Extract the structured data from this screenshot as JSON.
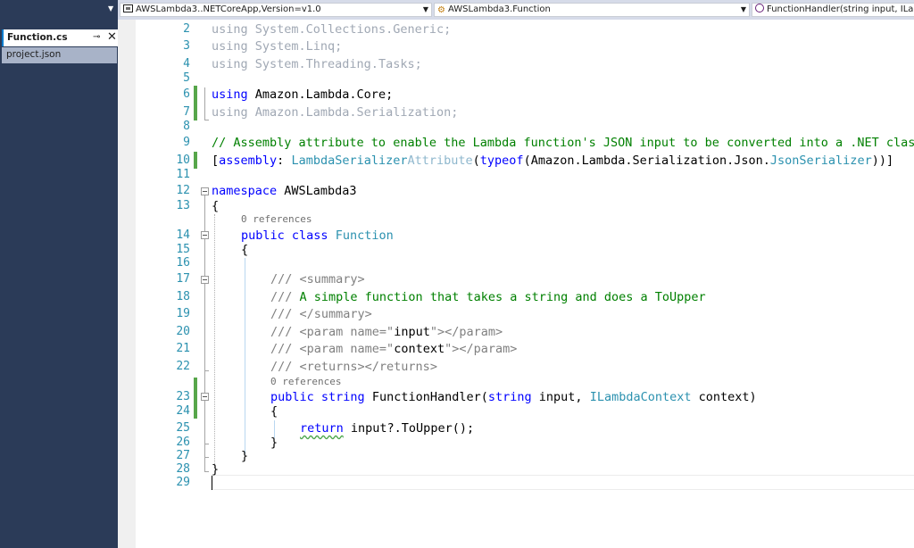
{
  "toolbar": {
    "project_dropdown": "AWSLambda3..NETCoreApp,Version=v1.0",
    "type_dropdown": "AWSLambda3.Function",
    "member_dropdown": "FunctionHandler(string input, ILambdaContext context)"
  },
  "sidebar": {
    "active_tab": "Function.cs",
    "pin_glyph": "⊸",
    "close_glyph": "✕",
    "inactive_tab": "project.json"
  },
  "editor": {
    "line_numbers": [
      "2",
      "3",
      "4",
      "5",
      "6",
      "7",
      "8",
      "9",
      "10",
      "11",
      "12",
      "13",
      "14",
      "15",
      "16",
      "17",
      "18",
      "19",
      "20",
      "21",
      "22",
      "23",
      "24",
      "25",
      "26",
      "27",
      "28",
      "29"
    ],
    "codelens": [
      "0 references",
      "0 references"
    ],
    "lines": {
      "l2": {
        "kw": "using",
        "rest": " System.Collections.Generic;"
      },
      "l3": {
        "kw": "using",
        "rest": " System.Linq;"
      },
      "l4": {
        "kw": "using",
        "rest": " System.Threading.Tasks;"
      },
      "l6": {
        "kw": "using",
        "rest": " Amazon.Lambda.Core;"
      },
      "l7": {
        "kw": "using",
        "rest": " Amazon.Lambda.Serialization;"
      },
      "l9": {
        "comment": "// Assembly attribute to enable the Lambda function's JSON input to be converted into a .NET class."
      },
      "l10": {
        "p1": "[",
        "kw1": "assembly",
        "p2": ": ",
        "t1": "LambdaSerializer",
        "t1b": "Attribute",
        "p3": "(",
        "kw2": "typeof",
        "p4": "(Amazon.Lambda.Serialization.Json.",
        "t2": "JsonSerializer",
        "p5": "))]"
      },
      "l12": {
        "kw": "namespace",
        "rest": " AWSLambda3"
      },
      "l13": {
        "text": "{"
      },
      "l14": {
        "kw1": "public",
        "kw2": "class",
        "t": "Function"
      },
      "l15": {
        "text": "{"
      },
      "l17": {
        "pre": "/// ",
        "tag": "<summary>"
      },
      "l18": {
        "pre": "/// ",
        "text": "A simple function that takes a string and does a ToUpper"
      },
      "l19": {
        "pre": "/// ",
        "tag": "</summary>"
      },
      "l20": {
        "pre": "/// ",
        "tag1": "<param name=\"",
        "val": "input",
        "tag2": "\"></param>"
      },
      "l21": {
        "pre": "/// ",
        "tag1": "<param name=\"",
        "val": "context",
        "tag2": "\"></param>"
      },
      "l22": {
        "pre": "/// ",
        "tag": "<returns></returns>"
      },
      "l23": {
        "kw1": "public",
        "kw2": "string",
        "name": " FunctionHandler(",
        "kw3": "string",
        "p1": " input, ",
        "t": "ILambdaContext",
        "p2": " context)"
      },
      "l24": {
        "text": "{"
      },
      "l25": {
        "kw": "return",
        "rest": " input?.ToUpper();"
      },
      "l26": {
        "text": "}"
      },
      "l27": {
        "text": "}"
      },
      "l28": {
        "text": "}"
      }
    }
  }
}
